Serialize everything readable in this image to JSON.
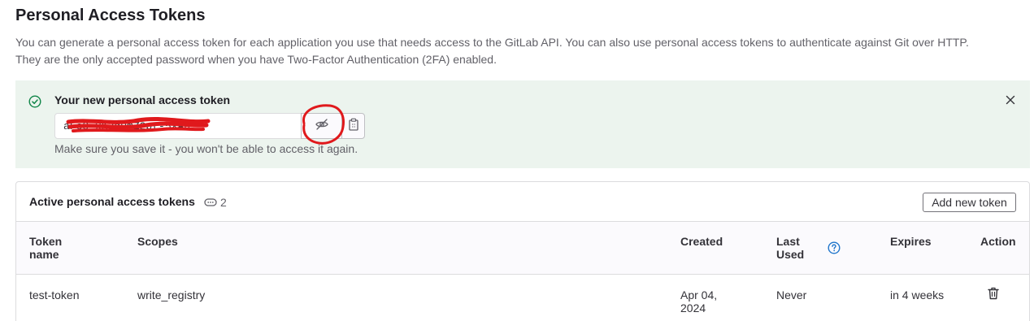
{
  "header": {
    "title": "Personal Access Tokens",
    "description_line1": "You can generate a personal access token for each application you use that needs access to the GitLab API. You can also use personal access tokens to authenticate against Git over HTTP.",
    "description_line2": "They are the only accepted password when you have Two-Factor Authentication (2FA) enabled."
  },
  "alert": {
    "title": "Your new personal access token",
    "token_value": "aFc8-xK3q9mZ2pt-5XAn",
    "note": "Make sure you save it - you won't be able to access it again.",
    "background": "#ecf4ee",
    "success_color": "#108548"
  },
  "tokens_card": {
    "title": "Active personal access tokens",
    "count": "2",
    "add_button_label": "Add new token",
    "columns": {
      "name_line1": "Token",
      "name_line2": "name",
      "scopes": "Scopes",
      "created": "Created",
      "last_used_line1": "Last",
      "last_used_line2": "Used",
      "expires": "Expires",
      "action": "Action"
    },
    "rows": [
      {
        "name": "test-token",
        "scopes": "write_registry",
        "created_line1": "Apr 04,",
        "created_line2": "2024",
        "last_used": "Never",
        "expires": "in 4 weeks"
      }
    ]
  },
  "annotations": {
    "markup_color": "#e0191c"
  }
}
